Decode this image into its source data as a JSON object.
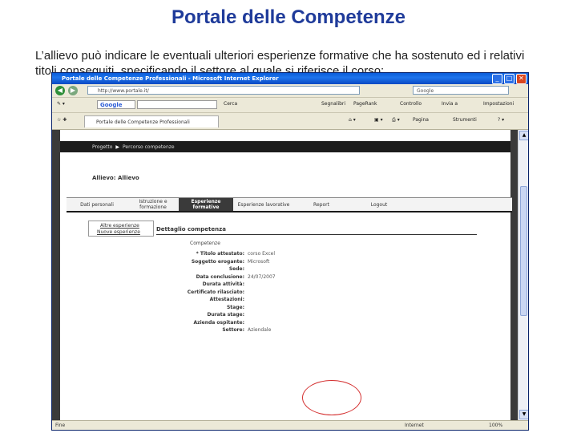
{
  "slide": {
    "title": "Portale delle Competenze",
    "text": "L’allievo può indicare le eventuali ulteriori esperienze formative che ha sostenuto ed i relativi titoli conseguiti, specificando il settore al quale si riferisce il corso:"
  },
  "browser": {
    "window_title": "Portale delle Competenze Professionali - Microsoft Internet Explorer",
    "address": "http://www.portale.it/",
    "search_placeholder": "Google",
    "google_label": "Google",
    "toolbar": [
      "Cerca",
      "Segnalibri",
      "PageRank",
      "Controllo",
      "Invia a",
      "Impostazioni"
    ],
    "tab_title": "Portale delle Competenze Professionali",
    "tab_tools": [
      "Pagina",
      "Strumenti"
    ],
    "status_left": "Fine",
    "status_zone": "Internet",
    "status_zoom": "100%"
  },
  "portal": {
    "breadcrumb": [
      "Progetto",
      "Percorso competenze"
    ],
    "student": "Allievo: Allievo",
    "menu": [
      "Dati personali",
      "Istruzione e formazione",
      "Esperienze formative",
      "Esperienze lavorative",
      "Report",
      "Logout"
    ],
    "side_links": [
      "Altre esperienze",
      "Nuove esperienze"
    ],
    "detail_title": "Dettaglio competenza",
    "section_label": "Competenze",
    "fields": [
      {
        "label": "* Titolo attestato:",
        "value": "corso Excel"
      },
      {
        "label": "Soggetto erogante:",
        "value": "Microsoft"
      },
      {
        "label": "Sede:",
        "value": ""
      },
      {
        "label": "Data conclusione:",
        "value": "24/07/2007"
      },
      {
        "label": "Durata attività:",
        "value": ""
      },
      {
        "label": "Certificato rilasciato:",
        "value": ""
      },
      {
        "label": "Attestazioni:",
        "value": ""
      },
      {
        "label": "Stage:",
        "value": ""
      },
      {
        "label": "Durata stage:",
        "value": ""
      },
      {
        "label": "Azienda ospitante:",
        "value": ""
      },
      {
        "label": "Settore:",
        "value": "Aziendale"
      }
    ],
    "highlight_color": "#d43030"
  }
}
